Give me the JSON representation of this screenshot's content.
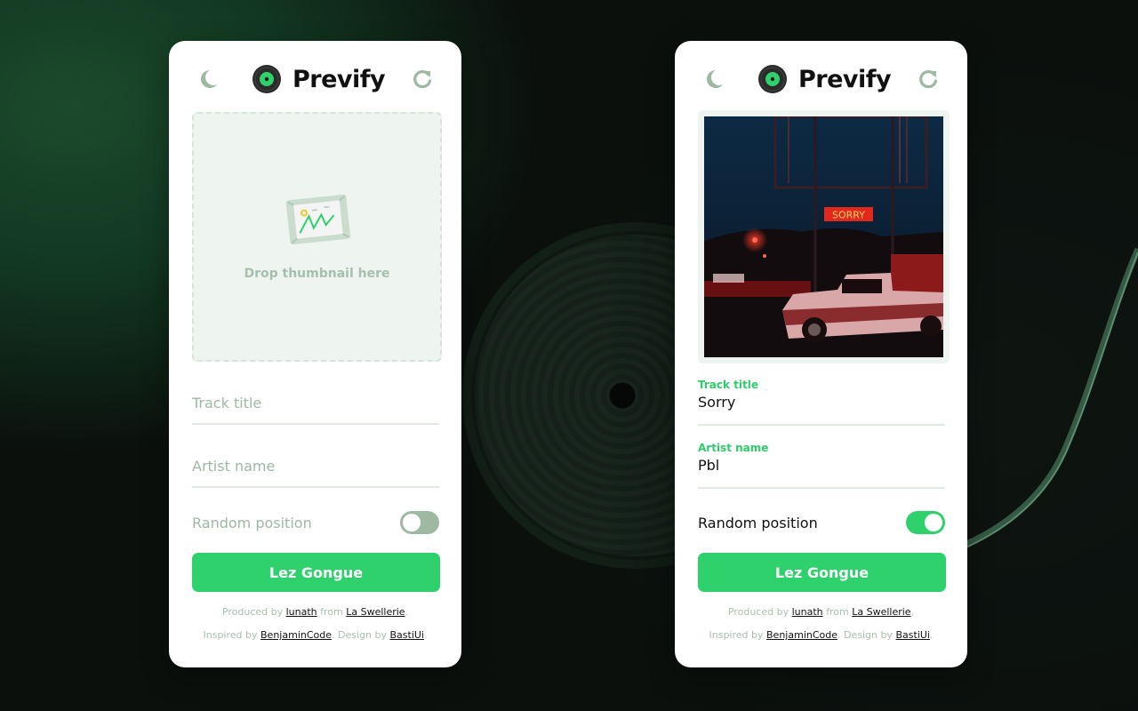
{
  "app": {
    "title": "Prevify",
    "accent_color": "#2ed16b",
    "muted_color": "#9db9a2"
  },
  "background": {
    "icons": [
      "vinyl-record-icon",
      "tonearm-icon"
    ]
  },
  "cards": [
    {
      "state": "empty",
      "header": {
        "theme_toggle_icon": "moon-icon",
        "refresh_icon": "refresh-icon",
        "logo_icon": "vinyl-disc-icon",
        "title": "Prevify"
      },
      "dropzone": {
        "icon": "picture-frame-icon",
        "text": "Drop thumbnail here"
      },
      "track_title": {
        "label": "Track title",
        "placeholder": "Track title",
        "value": ""
      },
      "artist_name": {
        "label": "Artist name",
        "placeholder": "Artist name",
        "value": ""
      },
      "random_position": {
        "label": "Random position",
        "enabled": false
      },
      "submit_label": "Lez Gongue",
      "credits": {
        "produced_prefix": "Produced by ",
        "producer": "lunath",
        "from_text": " from ",
        "studio": "La Swellerie",
        "period": ".",
        "inspired_prefix": "Inspired by ",
        "inspiration": "BenjaminCode",
        "design_text": ". Design by ",
        "designer": "BastiUi",
        "end": "."
      }
    },
    {
      "state": "filled",
      "header": {
        "theme_toggle_icon": "moon-icon",
        "refresh_icon": "refresh-icon",
        "logo_icon": "vinyl-disc-icon",
        "title": "Prevify"
      },
      "thumbnail": {
        "description": "Night photo of a red-lit pickup truck under a neon SORRY sign",
        "sign_text": "SORRY"
      },
      "track_title": {
        "label": "Track title",
        "placeholder": "Track title",
        "value": "Sorry"
      },
      "artist_name": {
        "label": "Artist name",
        "placeholder": "Artist name",
        "value": "Pbl"
      },
      "random_position": {
        "label": "Random position",
        "enabled": true
      },
      "submit_label": "Lez Gongue",
      "credits": {
        "produced_prefix": "Produced by ",
        "producer": "lunath",
        "from_text": " from ",
        "studio": "La Swellerie",
        "period": ".",
        "inspired_prefix": "Inspired by ",
        "inspiration": "BenjaminCode",
        "design_text": ". Design by ",
        "designer": "BastiUi",
        "end": "."
      }
    }
  ]
}
